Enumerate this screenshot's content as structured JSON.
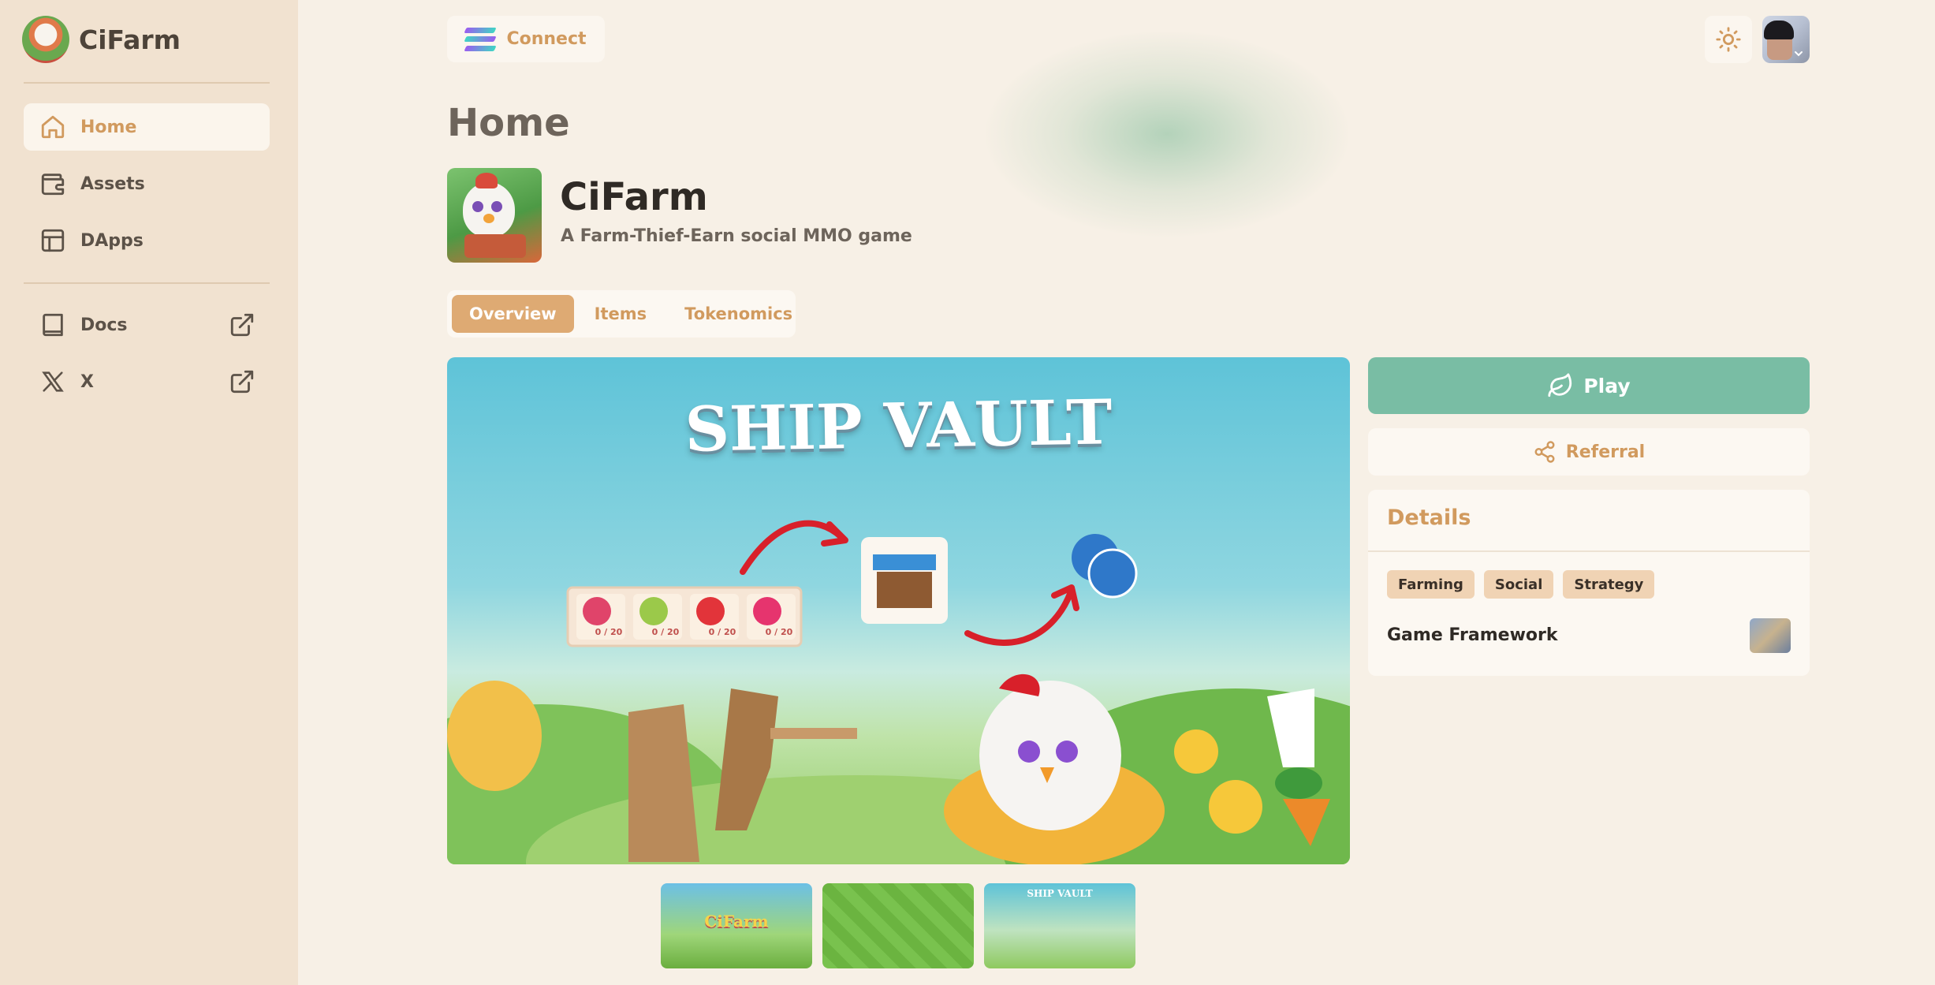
{
  "sidebar": {
    "brand": "CiFarm",
    "nav": [
      {
        "label": "Home",
        "icon": "home-icon",
        "active": true
      },
      {
        "label": "Assets",
        "icon": "wallet-icon",
        "active": false
      },
      {
        "label": "DApps",
        "icon": "layout-icon",
        "active": false
      }
    ],
    "links": [
      {
        "label": "Docs",
        "icon": "book-icon"
      },
      {
        "label": "X",
        "icon": "x-logo-icon"
      }
    ]
  },
  "header": {
    "connect_label": "Connect",
    "theme_icon": "sun-icon",
    "avatar_icon": "user-avatar"
  },
  "page": {
    "title": "Home",
    "app_name": "CiFarm",
    "app_tagline": "A Farm-Thief-Earn social MMO game",
    "tabs": [
      {
        "label": "Overview",
        "active": true
      },
      {
        "label": "Items",
        "active": false
      },
      {
        "label": "Tokenomics",
        "active": false
      }
    ],
    "banner": {
      "title": "SHIP VAULT",
      "counters": [
        "0 / 20",
        "0 / 20",
        "0 / 20",
        "0 / 20"
      ]
    },
    "thumbnails": [
      {
        "caption": "CiFarm",
        "selected": false
      },
      {
        "caption": "",
        "selected": false
      },
      {
        "caption": "SHIP VAULT",
        "selected": true
      }
    ]
  },
  "actions": {
    "play_label": "Play",
    "referral_label": "Referral"
  },
  "details": {
    "title": "Details",
    "tags": [
      "Farming",
      "Social",
      "Strategy"
    ],
    "framework_label": "Game Framework"
  },
  "colors": {
    "accent": "#d19a5e",
    "play": "#79bda4",
    "sidebar_bg": "#f1e2d0",
    "page_bg": "#f7f0e6"
  }
}
